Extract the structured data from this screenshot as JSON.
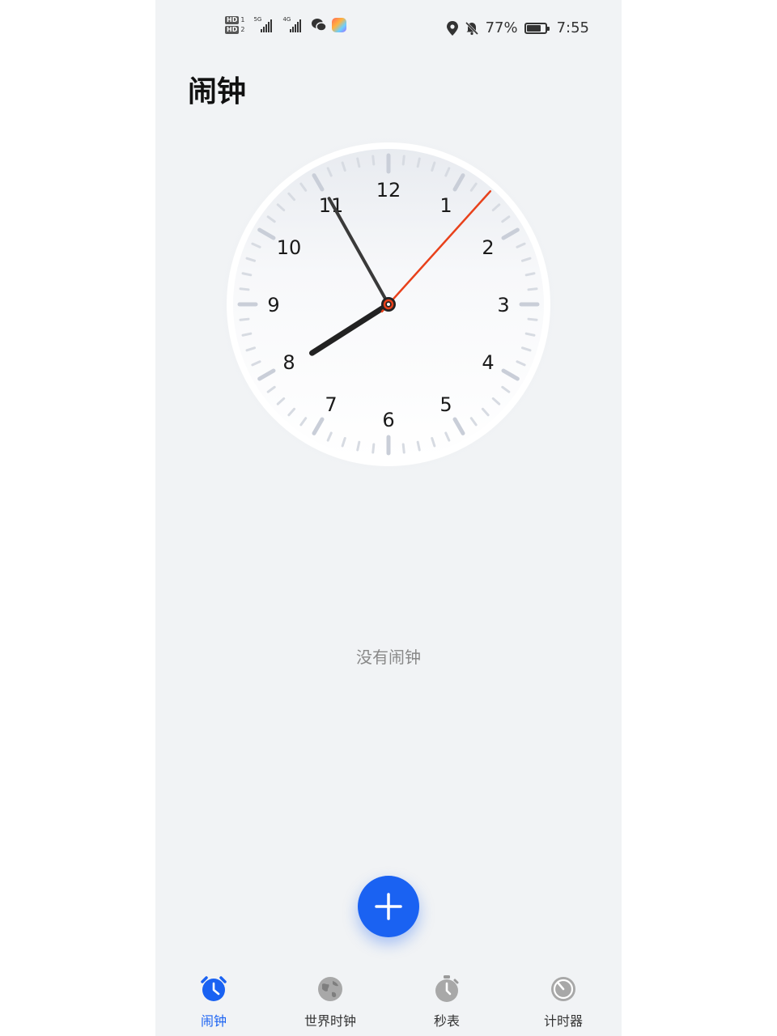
{
  "status_bar": {
    "sim1": {
      "badge": "HD",
      "num": "1"
    },
    "sim2": {
      "badge": "HD",
      "num": "2"
    },
    "net1": "5G",
    "net2": "4G",
    "battery_text": "77%",
    "battery_level": 0.77,
    "time": "7:55"
  },
  "page": {
    "title": "闹钟",
    "empty_message": "没有闹钟"
  },
  "clock": {
    "numerals": [
      "12",
      "1",
      "2",
      "3",
      "4",
      "5",
      "6",
      "7",
      "8",
      "9",
      "10",
      "11"
    ],
    "hours": 7,
    "minutes": 55,
    "seconds": 7,
    "second_hand_color": "#e8411b",
    "hand_color": "#222222"
  },
  "fab": {
    "icon": "plus-icon",
    "color": "#1a62f2"
  },
  "nav": {
    "items": [
      {
        "label": "闹钟",
        "icon": "alarm-clock-icon",
        "active": true
      },
      {
        "label": "世界时钟",
        "icon": "globe-icon",
        "active": false
      },
      {
        "label": "秒表",
        "icon": "stopwatch-icon",
        "active": false
      },
      {
        "label": "计时器",
        "icon": "timer-icon",
        "active": false
      }
    ],
    "active_color": "#1a62f2",
    "inactive_color": "#9a9a9a"
  }
}
